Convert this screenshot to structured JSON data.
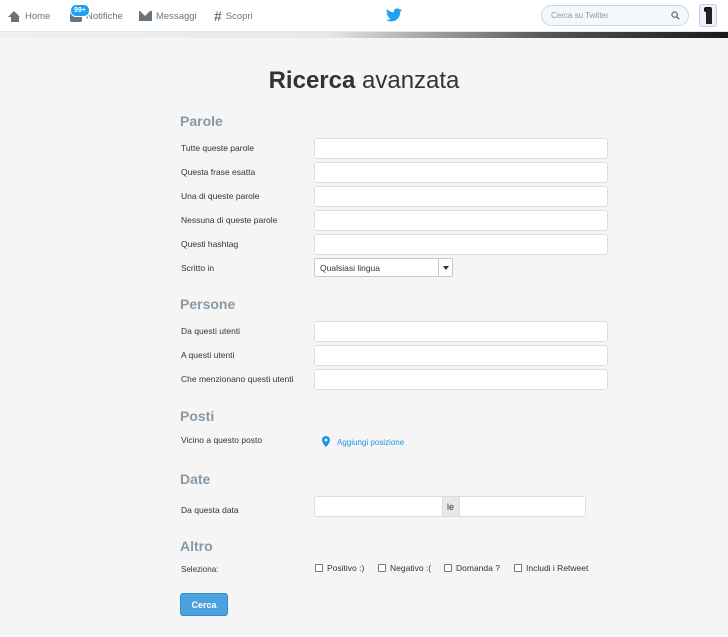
{
  "nav": {
    "home": "Home",
    "notifications": "Notifiche",
    "notifications_badge": "99+",
    "messages": "Messaggi",
    "discover": "Scopri",
    "search_placeholder": "Cerca su Twitter"
  },
  "page": {
    "title_bold": "Ricerca",
    "title_light": "avanzata"
  },
  "words": {
    "heading": "Parole",
    "all_words": "Tutte queste parole",
    "exact_phrase": "Questa frase esatta",
    "any_words": "Una di queste parole",
    "none_words": "Nessuna di queste parole",
    "hashtags": "Questi hashtag",
    "written_in": "Scritto in",
    "language_selected": "Qualsiasi lingua"
  },
  "people": {
    "heading": "Persone",
    "from_users": "Da questi utenti",
    "to_users": "A questi utenti",
    "mentioning_users": "Che menzionano questi utenti"
  },
  "places": {
    "heading": "Posti",
    "near_place": "Vicino a questo posto",
    "add_location": "Aggiungi posizione"
  },
  "dates": {
    "heading": "Date",
    "from_date": "Da questa data",
    "separator": "le"
  },
  "other": {
    "heading": "Altro",
    "select_label": "Seleziona:",
    "options": [
      "Positivo :)",
      "Negativo :(",
      "Domanda ?",
      "Includi i Retweet"
    ]
  },
  "submit_label": "Cerca",
  "colors": {
    "accent": "#1da1f2",
    "button": "#4aa3df",
    "heading": "#8899a6"
  }
}
